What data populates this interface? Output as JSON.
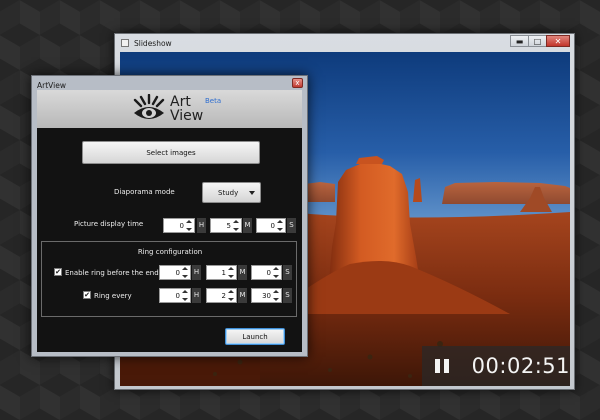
{
  "slideshow": {
    "title": "Slideshow",
    "buttons": {
      "minimize": "▬",
      "maximize": "□",
      "close": "✕"
    },
    "timer": "00:02:51"
  },
  "artview": {
    "title": "ArtView",
    "close_glyph": "x",
    "logo": {
      "word1": "Art",
      "word2": "View",
      "badge": "Beta"
    },
    "select_images_label": "Select images",
    "diaporama_mode": {
      "label": "Diaporama mode",
      "value": "Study"
    },
    "picture_display_time": {
      "label": "Picture display time",
      "hours": "0",
      "minutes": "5",
      "seconds": "0",
      "unit_h": "H",
      "unit_m": "M",
      "unit_s": "S"
    },
    "ring_configuration": {
      "title": "Ring configuration",
      "ring_before_end": {
        "label": "Enable ring before the end",
        "checked": true,
        "hours": "0",
        "minutes": "1",
        "seconds": "0",
        "unit_h": "H",
        "unit_m": "M",
        "unit_s": "S"
      },
      "ring_every": {
        "label": "Ring every",
        "checked": true,
        "hours": "0",
        "minutes": "2",
        "seconds": "30",
        "unit_h": "H",
        "unit_m": "M",
        "unit_s": "S"
      }
    },
    "launch_label": "Launch",
    "check_glyph": "✔"
  },
  "colors": {
    "accent_blue": "#2f6ecf",
    "panel_background": "#121212",
    "rock_orange": "#c2491d"
  }
}
